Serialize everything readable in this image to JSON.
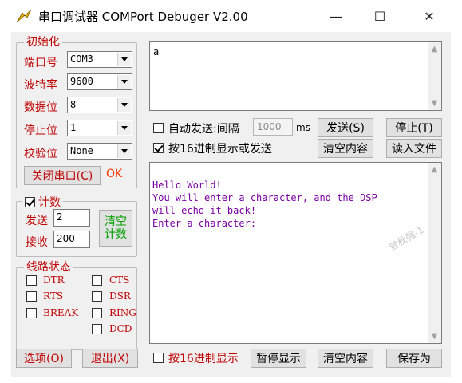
{
  "window": {
    "title": "串口调试器 COMPort Debuger V2.00",
    "min_glyph": "—",
    "max_glyph": "☐",
    "close_glyph": "✕"
  },
  "init": {
    "legend": "初始化",
    "port_label": "端口号",
    "port_value": "COM3",
    "baud_label": "波特率",
    "baud_value": "9600",
    "databits_label": "数据位",
    "databits_value": "8",
    "stopbits_label": "停止位",
    "stopbits_value": "1",
    "parity_label": "校验位",
    "parity_value": "None",
    "close_port_button": "关闭串口(C)",
    "status": "OK"
  },
  "count": {
    "legend": "计数",
    "checked": true,
    "send_label": "发送",
    "send_value": "2",
    "recv_label": "接收",
    "recv_value": "200",
    "clear_button": "清空计数"
  },
  "line_status": {
    "legend": "线路状态",
    "signals": [
      "DTR",
      "CTS",
      "RTS",
      "DSR",
      "BREAK",
      "RING",
      "DCD"
    ]
  },
  "send_area": {
    "text": "a",
    "auto_send_label": "自动发送:间隔",
    "interval_placeholder": "1000",
    "interval_unit": "ms",
    "send_button": "发送(S)",
    "stop_button": "停止(T)",
    "hex_send_label": "按16进制显示或发送",
    "hex_send_checked": true,
    "clear_button": "清空内容",
    "read_file_button": "读入文件"
  },
  "recv_area": {
    "lines": [
      "Hello World!",
      "You will enter a character, and the DSP",
      "will echo it back!",
      "Enter a character:"
    ],
    "watermark": "曾秋强-1"
  },
  "footer": {
    "options_button": "选项(O)",
    "exit_button": "退出(X)",
    "hex_display_label": "按16进制显示",
    "pause_button": "暂停显示",
    "clear_button": "清空内容",
    "save_button": "保存为"
  },
  "colors": {
    "label_red": "#c00000",
    "recv_text": "#7a00a0",
    "ok_text": "#ff3300"
  }
}
